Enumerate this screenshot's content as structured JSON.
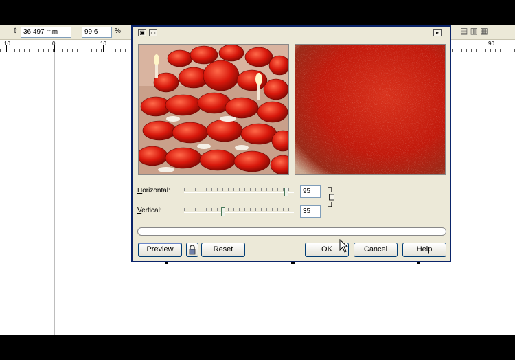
{
  "propbar": {
    "size_value": "36.497 mm",
    "scale_value": "99.6",
    "scale_unit": "%"
  },
  "ruler": {
    "labels": [
      "10",
      "0",
      "10",
      "90"
    ]
  },
  "dialog": {
    "horizontal_label_key": "H",
    "horizontal_label_rest": "orizontal:",
    "vertical_label_key": "V",
    "vertical_label_rest": "ertical:",
    "horizontal_value": "95",
    "vertical_value": "35",
    "horizontal_level_percent": 95,
    "vertical_level_percent": 35,
    "buttons": {
      "preview": "Preview",
      "reset": "Reset",
      "ok": "OK",
      "cancel": "Cancel",
      "help": "Help"
    }
  },
  "icons": [
    "height-icon",
    "collapse-icon",
    "dual-preview-icon",
    "expand-icon",
    "lock-icon",
    "link-chain-icon",
    "mouse-cursor-icon"
  ]
}
